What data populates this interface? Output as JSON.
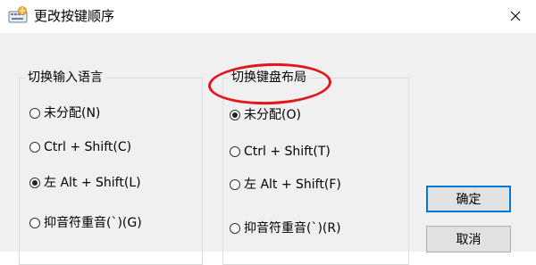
{
  "window": {
    "title": "更改按键顺序",
    "close_glyph": "✕"
  },
  "input_language_group": {
    "legend": "切换输入语言",
    "options": [
      {
        "label": "未分配(N)",
        "checked": false
      },
      {
        "label": "Ctrl + Shift(C)",
        "checked": false
      },
      {
        "label": "左 Alt + Shift(L)",
        "checked": true
      },
      {
        "label": "抑音符重音(`)(G)",
        "checked": false
      }
    ]
  },
  "keyboard_layout_group": {
    "legend": "切换键盘布局",
    "options": [
      {
        "label": "未分配(O)",
        "checked": true
      },
      {
        "label": "Ctrl + Shift(T)",
        "checked": false
      },
      {
        "label": "左 Alt + Shift(F)",
        "checked": false
      },
      {
        "label": "抑音符重音(`)(R)",
        "checked": false
      }
    ]
  },
  "buttons": {
    "ok": "确定",
    "cancel": "取消"
  },
  "colors": {
    "highlight": "#e3161c",
    "default_button_border": "#0078d7",
    "dialog_background": "#f0f0f0"
  },
  "icons": {
    "app": "keyboard-language-icon",
    "close": "close-icon"
  }
}
